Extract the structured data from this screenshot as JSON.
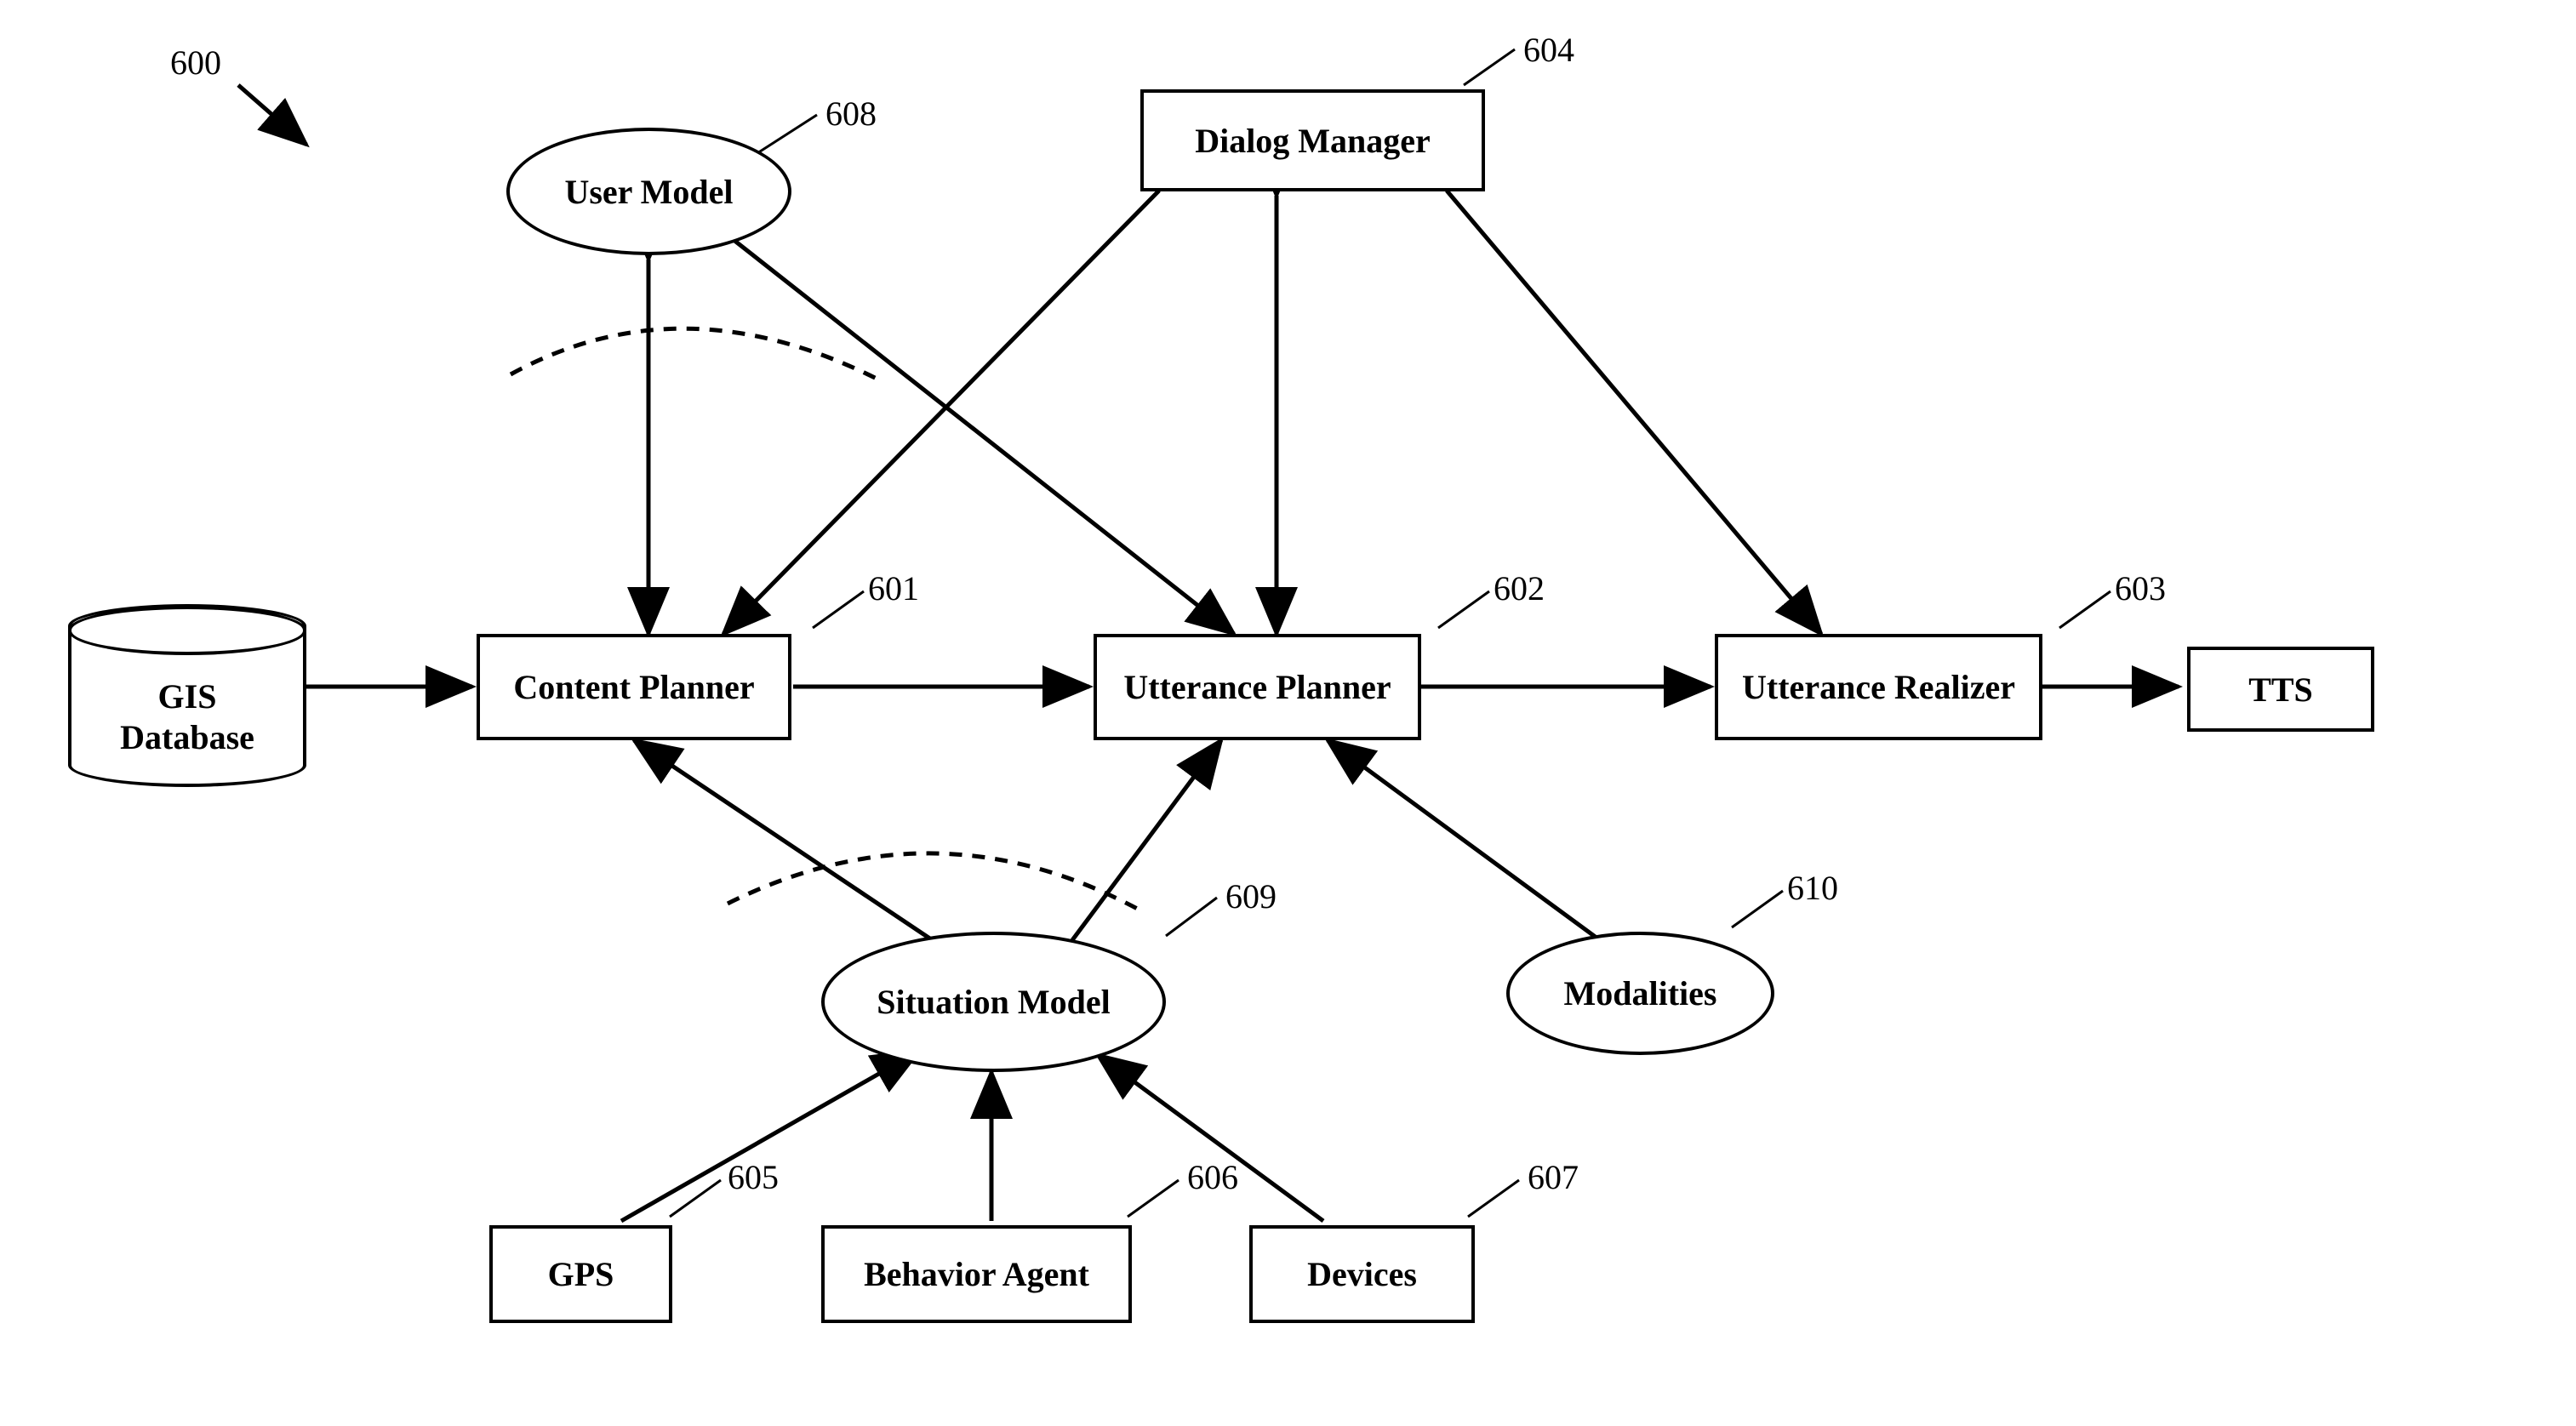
{
  "figure_ref": "600",
  "nodes": {
    "gis_database": {
      "label": "GIS\nDatabase"
    },
    "content_planner": {
      "label": "Content Planner",
      "ref": "601"
    },
    "utterance_planner": {
      "label": "Utterance Planner",
      "ref": "602"
    },
    "utterance_realizer": {
      "label": "Utterance Realizer",
      "ref": "603"
    },
    "dialog_manager": {
      "label": "Dialog Manager",
      "ref": "604"
    },
    "tts": {
      "label": "TTS"
    },
    "gps": {
      "label": "GPS",
      "ref": "605"
    },
    "behavior_agent": {
      "label": "Behavior Agent",
      "ref": "606"
    },
    "devices": {
      "label": "Devices",
      "ref": "607"
    },
    "user_model": {
      "label": "User Model",
      "ref": "608"
    },
    "situation_model": {
      "label": "Situation Model",
      "ref": "609"
    },
    "modalities": {
      "label": "Modalities",
      "ref": "610"
    }
  }
}
